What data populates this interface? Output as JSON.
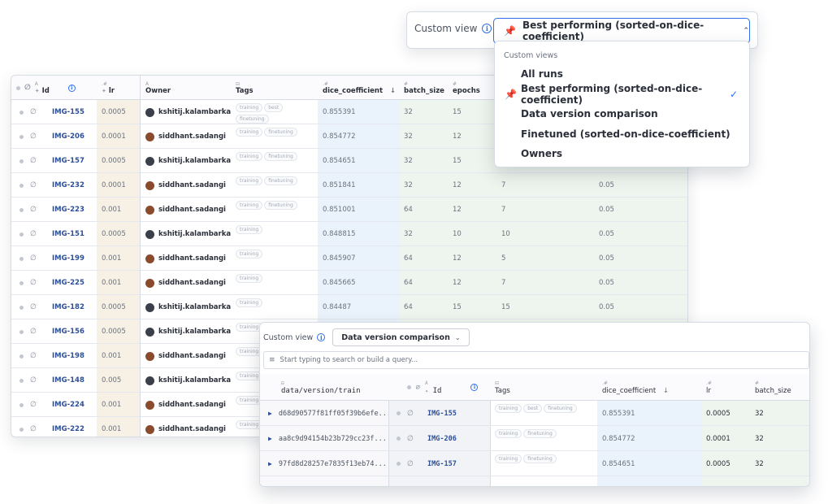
{
  "main_table": {
    "headers": {
      "id": "Id",
      "lr": "lr",
      "owner": "Owner",
      "tags": "Tags",
      "dice": "dice_coefficient",
      "batch": "batch_size",
      "epochs": "epochs"
    },
    "header_type_marks": {
      "id": "A",
      "lr": ".#",
      "owner": "A",
      "tags": "⊟",
      "dice": ".#",
      "batch": "#",
      "epochs": "#"
    },
    "sort_indicator": "↓",
    "rows": [
      {
        "id": "IMG-155",
        "lr": "0.0005",
        "owner": "kshitij.kalambarkar",
        "tags": [
          "training",
          "best",
          "finetuning"
        ],
        "dice": "0.855391",
        "batch": "32",
        "epochs": "15",
        "col7": "",
        "col8": ""
      },
      {
        "id": "IMG-206",
        "lr": "0.0001",
        "owner": "siddhant.sadangi",
        "tags": [
          "training",
          "finetuning"
        ],
        "dice": "0.854772",
        "batch": "32",
        "epochs": "12",
        "col7": "",
        "col8": ""
      },
      {
        "id": "IMG-157",
        "lr": "0.0005",
        "owner": "kshitij.kalambarkar",
        "tags": [
          "training",
          "finetuning"
        ],
        "dice": "0.854651",
        "batch": "32",
        "epochs": "15",
        "col7": "",
        "col8": ""
      },
      {
        "id": "IMG-232",
        "lr": "0.0001",
        "owner": "siddhant.sadangi",
        "tags": [
          "training",
          "finetuning"
        ],
        "dice": "0.851841",
        "batch": "32",
        "epochs": "12",
        "col7": "7",
        "col8": "0.05"
      },
      {
        "id": "IMG-223",
        "lr": "0.001",
        "owner": "siddhant.sadangi",
        "tags": [
          "training",
          "finetuning"
        ],
        "dice": "0.851001",
        "batch": "64",
        "epochs": "12",
        "col7": "7",
        "col8": "0.05"
      },
      {
        "id": "IMG-151",
        "lr": "0.0005",
        "owner": "kshitij.kalambarkar",
        "tags": [
          "training"
        ],
        "dice": "0.848815",
        "batch": "32",
        "epochs": "10",
        "col7": "10",
        "col8": "0.05"
      },
      {
        "id": "IMG-199",
        "lr": "0.001",
        "owner": "siddhant.sadangi",
        "tags": [
          "training"
        ],
        "dice": "0.845907",
        "batch": "64",
        "epochs": "12",
        "col7": "5",
        "col8": "0.05"
      },
      {
        "id": "IMG-225",
        "lr": "0.001",
        "owner": "siddhant.sadangi",
        "tags": [
          "training"
        ],
        "dice": "0.845665",
        "batch": "64",
        "epochs": "12",
        "col7": "7",
        "col8": "0.05"
      },
      {
        "id": "IMG-182",
        "lr": "0.0005",
        "owner": "kshitij.kalambarkar",
        "tags": [
          "training"
        ],
        "dice": "0.84487",
        "batch": "64",
        "epochs": "15",
        "col7": "15",
        "col8": "0.05"
      },
      {
        "id": "IMG-156",
        "lr": "0.0005",
        "owner": "kshitij.kalambarkar",
        "tags": [
          "training"
        ],
        "dice": "",
        "batch": "",
        "epochs": "",
        "col7": "",
        "col8": ""
      },
      {
        "id": "IMG-198",
        "lr": "0.001",
        "owner": "siddhant.sadangi",
        "tags": [
          "training"
        ],
        "dice": "",
        "batch": "",
        "epochs": "",
        "col7": "",
        "col8": ""
      },
      {
        "id": "IMG-148",
        "lr": "0.005",
        "owner": "kshitij.kalambarkar",
        "tags": [
          "training"
        ],
        "dice": "",
        "batch": "",
        "epochs": "",
        "col7": "",
        "col8": ""
      },
      {
        "id": "IMG-224",
        "lr": "0.001",
        "owner": "siddhant.sadangi",
        "tags": [
          "training"
        ],
        "dice": "",
        "batch": "",
        "epochs": "",
        "col7": "",
        "col8": ""
      },
      {
        "id": "IMG-222",
        "lr": "0.001",
        "owner": "siddhant.sadangi",
        "tags": [
          "training"
        ],
        "dice": "",
        "batch": "",
        "epochs": "",
        "col7": "",
        "col8": ""
      }
    ]
  },
  "custom_view_top": {
    "label": "Custom view",
    "selected": "Best performing (sorted-on-dice-coefficient)",
    "chevron": "⌃"
  },
  "dropdown_menu": {
    "heading": "Custom views",
    "items": [
      {
        "label": "All runs",
        "pinned": false,
        "checked": false
      },
      {
        "label": "Best performing (sorted-on-dice-coefficient)",
        "pinned": true,
        "checked": true
      },
      {
        "label": "Data version comparison",
        "pinned": false,
        "checked": false
      },
      {
        "label": "Finetuned (sorted-on-dice-coefficient)",
        "pinned": false,
        "checked": false
      },
      {
        "label": "Owners",
        "pinned": false,
        "checked": false
      }
    ],
    "check_glyph": "✓"
  },
  "overlay": {
    "custom_view_label": "Custom view",
    "selected": "Data version comparison",
    "chevron": "⌄",
    "search_placeholder": "Start typing to search or build a query...",
    "headers": {
      "data_version": "data/version/train",
      "id": "Id",
      "tags": "Tags",
      "dice": "dice_coefficient",
      "lr": "lr",
      "batch": "batch_size"
    },
    "header_type_marks": {
      "data_version": "⊟",
      "id": "A",
      "tags": "⊟",
      "dice": ".#",
      "lr": ".#",
      "batch": "#"
    },
    "sort_indicator": "↓",
    "rows": [
      {
        "hash": "d68d90577f81ff05f39b6efe...",
        "id": "IMG-155",
        "tags": [
          "training",
          "best",
          "finetuning"
        ],
        "dice": "0.855391",
        "lr": "0.0005",
        "batch": "32"
      },
      {
        "hash": "aa8c9d94154b23b729cc23f...",
        "id": "IMG-206",
        "tags": [
          "training",
          "finetuning"
        ],
        "dice": "0.854772",
        "lr": "0.0001",
        "batch": "32"
      },
      {
        "hash": "97fd8d28257e7835f13eb74...",
        "id": "IMG-157",
        "tags": [
          "training",
          "finetuning"
        ],
        "dice": "0.854651",
        "lr": "0.0005",
        "batch": "32"
      }
    ]
  },
  "colors": {
    "accent": "#2d6ff0",
    "id_link": "#2c4f9b",
    "lr_column_bg": "#f6f1e4",
    "dice_column_bg": "#eaf2fb",
    "numeric_columns_bg": "#eef5ee",
    "avatar_kshitij": "#3a3f4a",
    "avatar_siddhant": "#8a4a2c"
  },
  "icons": {
    "row_pin": "pin-icon",
    "visibility": "eye-off-icon",
    "info": "info-icon",
    "filter": "filter-icon",
    "expand": "caret-right-icon"
  }
}
